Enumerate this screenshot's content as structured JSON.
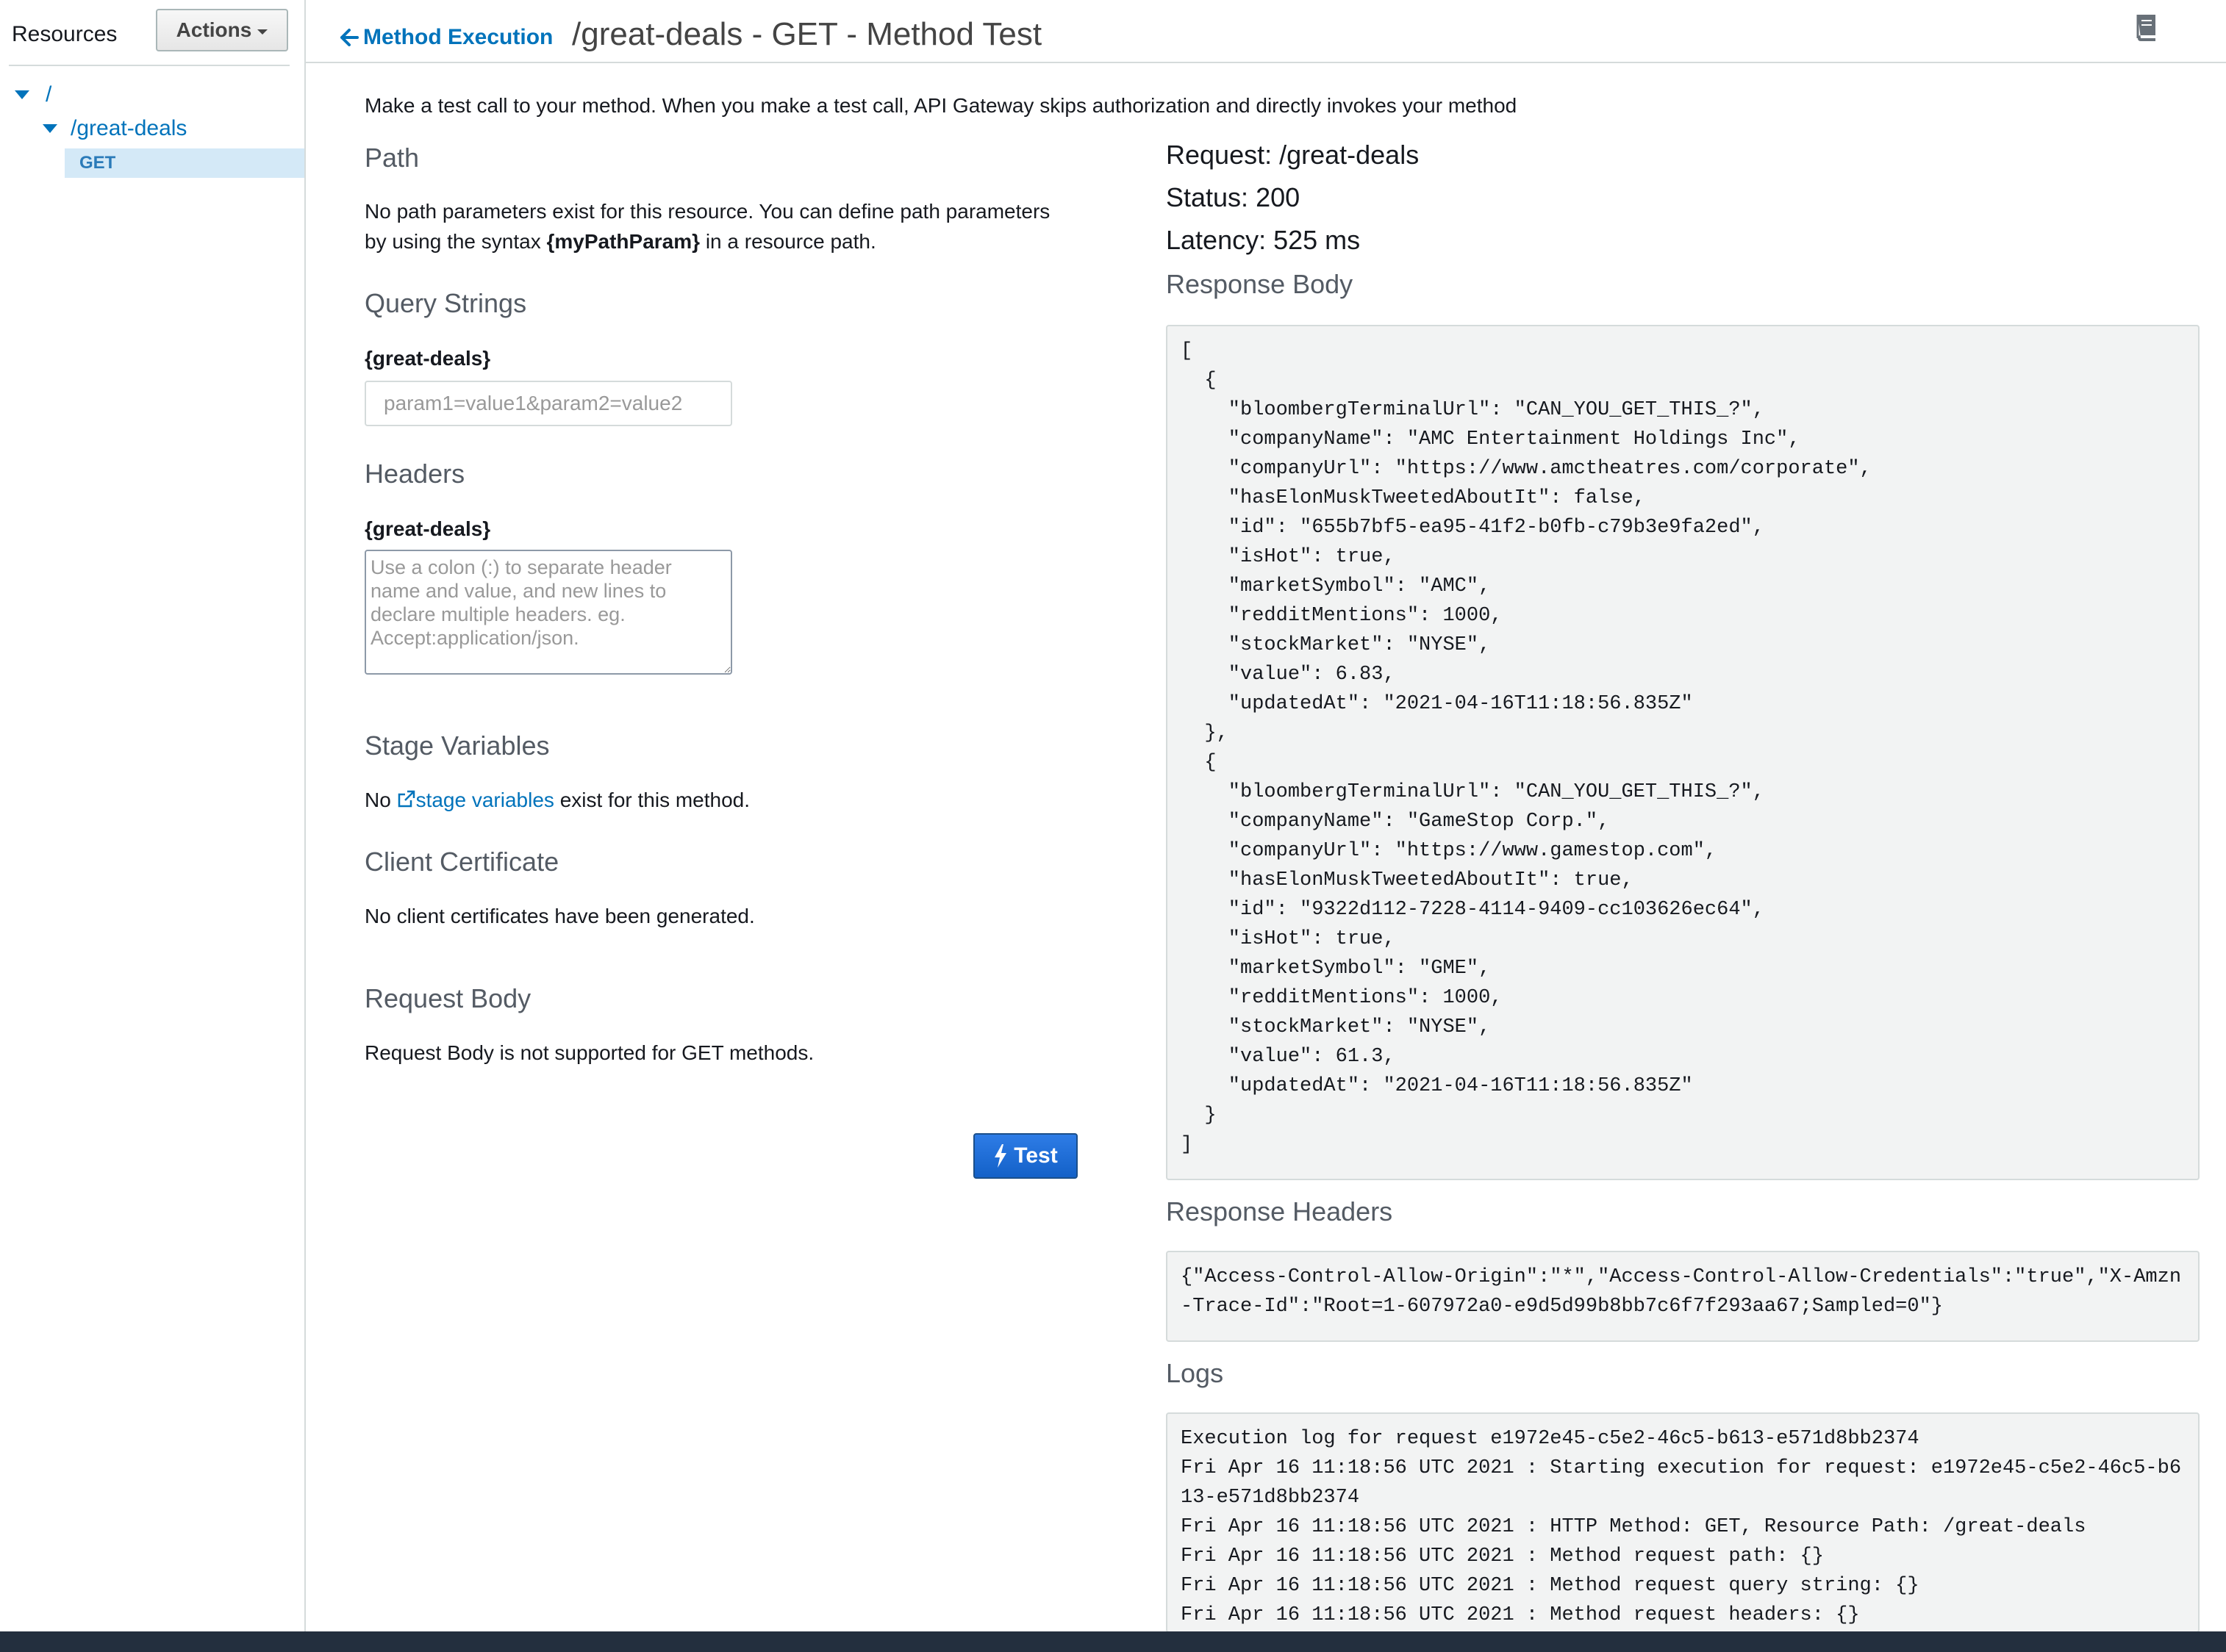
{
  "sidebar": {
    "title": "Resources",
    "actions_label": "Actions",
    "tree": {
      "root": "/",
      "resource": "/great-deals",
      "method": "GET"
    }
  },
  "header": {
    "back_label": "Method Execution",
    "title": "/great-deals - GET - Method Test"
  },
  "intro": "Make a test call to your method. When you make a test call, API Gateway skips authorization and directly invokes your method",
  "path_section": {
    "heading": "Path",
    "line1": "No path parameters exist for this resource. You can define path parameters",
    "line2_prefix": "by using the syntax ",
    "line2_bold": "{myPathParam}",
    "line2_suffix": " in a resource path."
  },
  "query_strings": {
    "heading": "Query Strings",
    "label": "{great-deals}",
    "placeholder": "param1=value1&param2=value2"
  },
  "headers_section": {
    "heading": "Headers",
    "label": "{great-deals}",
    "placeholder": "Use a colon (:) to separate header name and value, and new lines to declare multiple headers. eg. Accept:application/json."
  },
  "stage_variables": {
    "heading": "Stage Variables",
    "prefix": "No ",
    "link": "stage variables",
    "suffix": " exist for this method."
  },
  "client_certificate": {
    "heading": "Client Certificate",
    "text": "No client certificates have been generated."
  },
  "request_body": {
    "heading": "Request Body",
    "text": "Request Body is not supported for GET methods."
  },
  "test_button": "Test",
  "result": {
    "request": "Request: /great-deals",
    "status": "Status: 200",
    "latency": "Latency: 525 ms",
    "response_body_heading": "Response Body",
    "response_body_lines": [
      "[",
      "  {",
      "    \"bloombergTerminalUrl\": \"CAN_YOU_GET_THIS_?\",",
      "    \"companyName\": \"AMC Entertainment Holdings Inc\",",
      "    \"companyUrl\": \"https://www.amctheatres.com/corporate\",",
      "    \"hasElonMuskTweetedAboutIt\": false,",
      "    \"id\": \"655b7bf5-ea95-41f2-b0fb-c79b3e9fa2ed\",",
      "    \"isHot\": true,",
      "    \"marketSymbol\": \"AMC\",",
      "    \"redditMentions\": 1000,",
      "    \"stockMarket\": \"NYSE\",",
      "    \"value\": 6.83,",
      "    \"updatedAt\": \"2021-04-16T11:18:56.835Z\"",
      "  },",
      "  {",
      "    \"bloombergTerminalUrl\": \"CAN_YOU_GET_THIS_?\",",
      "    \"companyName\": \"GameStop Corp.\",",
      "    \"companyUrl\": \"https://www.gamestop.com\",",
      "    \"hasElonMuskTweetedAboutIt\": true,",
      "    \"id\": \"9322d112-7228-4114-9409-cc103626ec64\",",
      "    \"isHot\": true,",
      "    \"marketSymbol\": \"GME\",",
      "    \"redditMentions\": 1000,",
      "    \"stockMarket\": \"NYSE\",",
      "    \"value\": 61.3,",
      "    \"updatedAt\": \"2021-04-16T11:18:56.835Z\"",
      "  }",
      "]"
    ],
    "response_headers_heading": "Response Headers",
    "response_headers": "{\"Access-Control-Allow-Origin\":\"*\",\"Access-Control-Allow-Credentials\":\"true\",\"X-Amzn-Trace-Id\":\"Root=1-607972a0-e9d5d99b8bb7c6f7f293aa67;Sampled=0\"}",
    "logs_heading": "Logs",
    "log_lines": [
      "Execution log for request e1972e45-c5e2-46c5-b613-e571d8bb2374",
      "Fri Apr 16 11:18:56 UTC 2021 : Starting execution for request: e1972e45-c5e2-46c5-b613-e571d8bb2374",
      "Fri Apr 16 11:18:56 UTC 2021 : HTTP Method: GET, Resource Path: /great-deals",
      "Fri Apr 16 11:18:56 UTC 2021 : Method request path: {}",
      "Fri Apr 16 11:18:56 UTC 2021 : Method request query string: {}",
      "Fri Apr 16 11:18:56 UTC 2021 : Method request headers: {}"
    ]
  },
  "colors": {
    "link": "#0073bb",
    "primary_button": "#1361c8",
    "code_bg": "#f2f3f3",
    "footer": "#232f3e",
    "selected_bg": "#d4e9f7"
  }
}
